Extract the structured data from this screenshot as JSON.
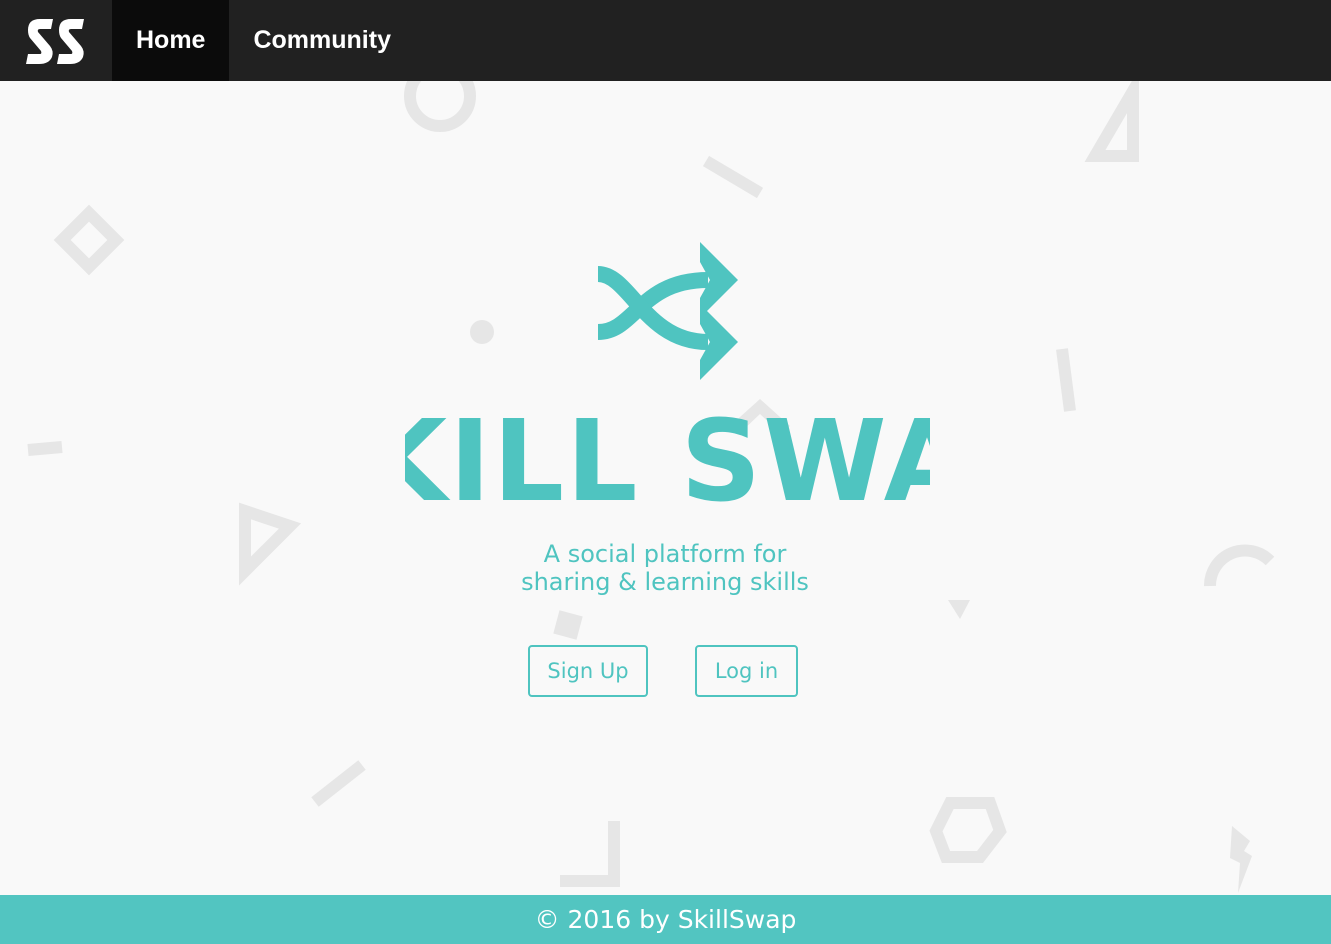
{
  "navbar": {
    "logo_text": "SS",
    "items": [
      {
        "label": "Home",
        "active": true
      },
      {
        "label": "Community",
        "active": false
      }
    ]
  },
  "hero": {
    "icon": "shuffle-arrows-icon",
    "title": "SKILL SWAP",
    "tagline_line1": "A social platform for",
    "tagline_line2": "sharing & learning skills"
  },
  "actions": {
    "signup_label": "Sign Up",
    "login_label": "Log in"
  },
  "footer": {
    "copyright": "© 2016 by SkillSwap"
  },
  "colors": {
    "accent": "#4fc4c0",
    "footer_bg": "#52c5c1",
    "navbar_bg": "#212121",
    "navbar_active_bg": "#0b0b0b",
    "page_bg": "#f9f9f9",
    "deco_shape": "#e6e6e6"
  }
}
